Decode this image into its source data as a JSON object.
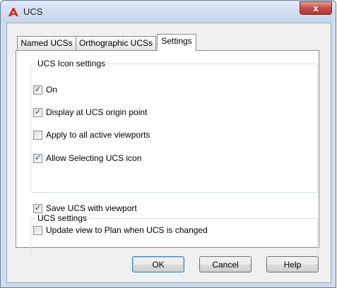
{
  "window": {
    "title": "UCS",
    "close_glyph": "x",
    "app_icon": "autocad-a-icon",
    "close_color": "#c75050"
  },
  "tabs": [
    {
      "label": "Named UCSs",
      "active": false
    },
    {
      "label": "Orthographic UCSs",
      "active": false
    },
    {
      "label": "Settings",
      "active": true
    }
  ],
  "ucs_icon_settings": {
    "title": "UCS Icon settings",
    "options": [
      {
        "label": "On",
        "checked": true
      },
      {
        "label": "Display at UCS origin point",
        "checked": true
      },
      {
        "label": "Apply to all active viewports",
        "checked": false
      },
      {
        "label": "Allow Selecting UCS icon",
        "checked": true
      }
    ]
  },
  "ucs_settings": {
    "title": "UCS settings",
    "options": [
      {
        "label": "Save UCS with viewport",
        "checked": true
      },
      {
        "label": "Update view to Plan when UCS is changed",
        "checked": false
      }
    ]
  },
  "buttons": {
    "ok": "OK",
    "cancel": "Cancel",
    "help": "Help"
  }
}
